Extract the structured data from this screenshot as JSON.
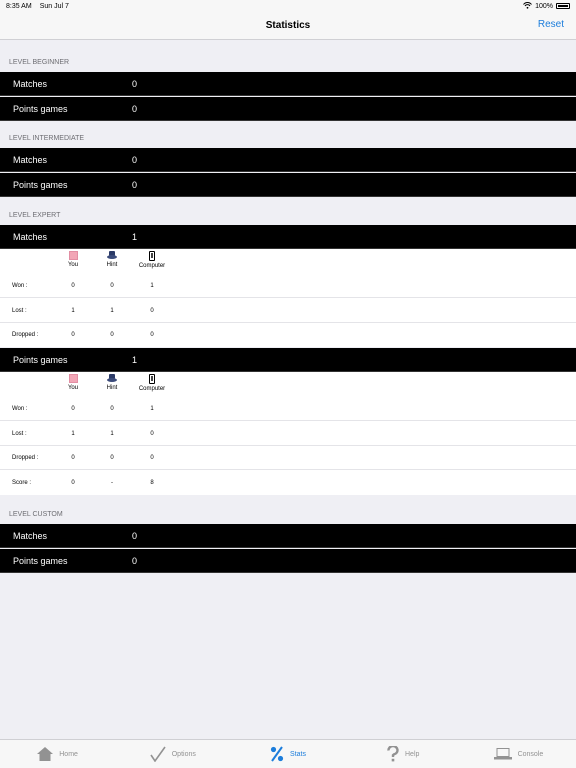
{
  "status_bar": {
    "time": "8:35 AM",
    "date": "Sun Jul 7",
    "battery": "100%"
  },
  "nav": {
    "title": "Statistics",
    "reset_label": "Reset"
  },
  "beginner": {
    "header": "LEVEL BEGINNER",
    "rows": [
      {
        "label": "Matches",
        "value": "0"
      },
      {
        "label": "Points games",
        "value": "0"
      }
    ]
  },
  "intermediate": {
    "header": "LEVEL INTERMEDIATE",
    "rows": [
      {
        "label": "Matches",
        "value": "0"
      },
      {
        "label": "Points games",
        "value": "0"
      }
    ]
  },
  "expert": {
    "header": "LEVEL EXPERT",
    "matches": {
      "label": "Matches",
      "value": "1",
      "columns": [
        "You",
        "Hint",
        "Computer"
      ],
      "rows": [
        {
          "label": "Won :",
          "values": [
            "0",
            "0",
            "1"
          ]
        },
        {
          "label": "Lost :",
          "values": [
            "1",
            "1",
            "0"
          ]
        },
        {
          "label": "Dropped :",
          "values": [
            "0",
            "0",
            "0"
          ]
        }
      ]
    },
    "points": {
      "label": "Points games",
      "value": "1",
      "columns": [
        "You",
        "Hint",
        "Computer"
      ],
      "rows": [
        {
          "label": "Won :",
          "values": [
            "0",
            "0",
            "1"
          ]
        },
        {
          "label": "Lost :",
          "values": [
            "1",
            "1",
            "0"
          ]
        },
        {
          "label": "Dropped :",
          "values": [
            "0",
            "0",
            "0"
          ]
        },
        {
          "label": "Score :",
          "values": [
            "0",
            "-",
            "8"
          ]
        }
      ]
    }
  },
  "custom": {
    "header": "LEVEL CUSTOM",
    "rows": [
      {
        "label": "Matches",
        "value": "0"
      },
      {
        "label": "Points games",
        "value": "0"
      }
    ]
  },
  "tabs": [
    {
      "label": "Home",
      "icon": "home-icon"
    },
    {
      "label": "Options",
      "icon": "checkmark-icon"
    },
    {
      "label": "Stats",
      "icon": "percent-icon"
    },
    {
      "label": "Help",
      "icon": "question-icon"
    },
    {
      "label": "Console",
      "icon": "console-icon"
    }
  ],
  "colors": {
    "accent": "#1c7ddb",
    "row_bg": "#000000",
    "page_bg": "#efeff4"
  }
}
